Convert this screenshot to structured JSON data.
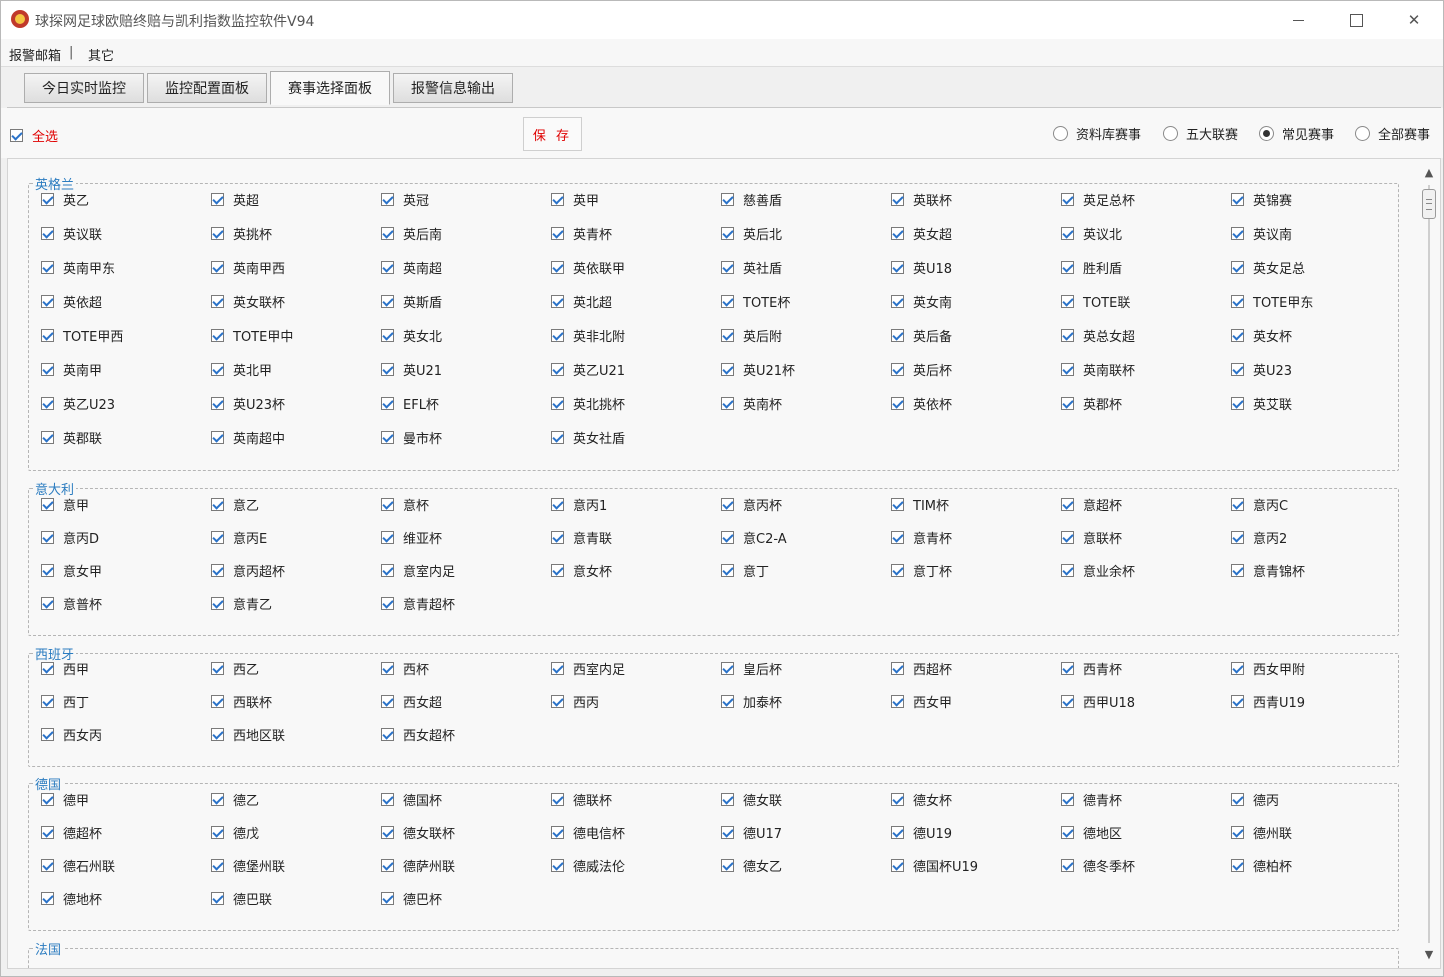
{
  "window": {
    "title": "球探网足球欧赔终赔与凯利指数监控软件V94"
  },
  "menu": {
    "items": [
      "报警邮箱",
      "其它"
    ],
    "separator": "|"
  },
  "tabs": [
    "今日实时监控",
    "监控配置面板",
    "赛事选择面板",
    "报警信息输出"
  ],
  "active_tab": "赛事选择面板",
  "toolbar": {
    "select_all_label": "全选",
    "select_all_checked": true,
    "save_label": "保 存",
    "radios": [
      {
        "label": "资料库赛事",
        "checked": false
      },
      {
        "label": "五大联赛",
        "checked": false
      },
      {
        "label": "常见赛事",
        "checked": true
      },
      {
        "label": "全部赛事",
        "checked": false
      }
    ]
  },
  "groups": [
    {
      "title": "英格兰",
      "items": [
        "英乙",
        "英超",
        "英冠",
        "英甲",
        "慈善盾",
        "英联杯",
        "英足总杯",
        "英锦赛",
        "英议联",
        "英挑杯",
        "英后南",
        "英青杯",
        "英后北",
        "英女超",
        "英议北",
        "英议南",
        "英南甲东",
        "英南甲西",
        "英南超",
        "英依联甲",
        "英社盾",
        "英U18",
        "胜利盾",
        "英女足总",
        "英依超",
        "英女联杯",
        "英斯盾",
        "英北超",
        "TOTE杯",
        "英女南",
        "TOTE联",
        "TOTE甲东",
        "TOTE甲西",
        "TOTE甲中",
        "英女北",
        "英非北附",
        "英后附",
        "英后备",
        "英总女超",
        "英女杯",
        "英南甲",
        "英北甲",
        "英U21",
        "英乙U21",
        "英U21杯",
        "英后杯",
        "英南联杯",
        "英U23",
        "英乙U23",
        "英U23杯",
        "EFL杯",
        "英北挑杯",
        "英南杯",
        "英依杯",
        "英郡杯",
        "英艾联",
        "英郡联",
        "英南超中",
        "曼市杯",
        "英女社盾"
      ]
    },
    {
      "title": "意大利",
      "items": [
        "意甲",
        "意乙",
        "意杯",
        "意丙1",
        "意丙杯",
        "TIM杯",
        "意超杯",
        "意丙C",
        "意丙D",
        "意丙E",
        "维亚杯",
        "意青联",
        "意C2-A",
        "意青杯",
        "意联杯",
        "意丙2",
        "意女甲",
        "意丙超杯",
        "意室内足",
        "意女杯",
        "意丁",
        "意丁杯",
        "意业余杯",
        "意青锦杯",
        "意普杯",
        "意青乙",
        "意青超杯"
      ]
    },
    {
      "title": "西班牙",
      "items": [
        "西甲",
        "西乙",
        "西杯",
        "西室内足",
        "皇后杯",
        "西超杯",
        "西青杯",
        "西女甲附",
        "西丁",
        "西联杯",
        "西女超",
        "西丙",
        "加泰杯",
        "西女甲",
        "西甲U18",
        "西青U19",
        "西女丙",
        "西地区联",
        "西女超杯"
      ]
    },
    {
      "title": "德国",
      "items": [
        "德甲",
        "德乙",
        "德国杯",
        "德联杯",
        "德女联",
        "德女杯",
        "德青杯",
        "德丙",
        "德超杯",
        "德戊",
        "德女联杯",
        "德电信杯",
        "德U17",
        "德U19",
        "德地区",
        "德州联",
        "德石州联",
        "德堡州联",
        "德萨州联",
        "德威法伦",
        "德女乙",
        "德国杯U19",
        "德冬季杯",
        "德柏杯",
        "德地杯",
        "德巴联",
        "德巴杯"
      ]
    },
    {
      "title": "法国",
      "items": []
    }
  ]
}
